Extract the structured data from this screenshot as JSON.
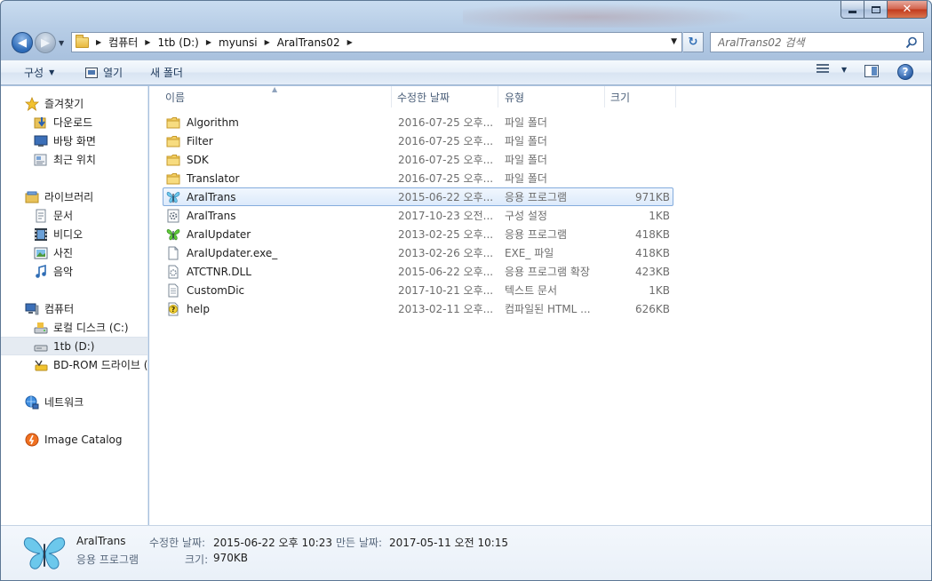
{
  "window": {
    "controls": {
      "minimize": "",
      "maximize": "",
      "close": "✕"
    }
  },
  "address": {
    "crumbs": [
      "컴퓨터",
      "1tb (D:)",
      "myunsi",
      "AralTrans02"
    ]
  },
  "search": {
    "placeholder": "AralTrans02 검색"
  },
  "toolbar": {
    "organize_label": "구성",
    "open_label": "열기",
    "new_folder_label": "새 폴더"
  },
  "nav": {
    "favorites": {
      "label": "즐겨찾기",
      "items": [
        "다운로드",
        "바탕 화면",
        "최근 위치"
      ]
    },
    "libraries": {
      "label": "라이브러리",
      "items": [
        "문서",
        "비디오",
        "사진",
        "음악"
      ]
    },
    "computer": {
      "label": "컴퓨터",
      "items": [
        "로컬 디스크 (C:)",
        "1tb (D:)",
        "BD-ROM 드라이브 ("
      ]
    },
    "network": {
      "label": "네트워크"
    },
    "image_catalog": {
      "label": "Image Catalog"
    }
  },
  "columns": {
    "name": "이름",
    "date": "수정한 날짜",
    "type": "유형",
    "size": "크기"
  },
  "files": [
    {
      "name": "Algorithm",
      "date": "2016-07-25 오후...",
      "type": "파일 폴더",
      "size": "",
      "icon": "folder-icon"
    },
    {
      "name": "Filter",
      "date": "2016-07-25 오후...",
      "type": "파일 폴더",
      "size": "",
      "icon": "folder-icon"
    },
    {
      "name": "SDK",
      "date": "2016-07-25 오후...",
      "type": "파일 폴더",
      "size": "",
      "icon": "folder-icon"
    },
    {
      "name": "Translator",
      "date": "2016-07-25 오후...",
      "type": "파일 폴더",
      "size": "",
      "icon": "folder-icon"
    },
    {
      "name": "AralTrans",
      "date": "2015-06-22 오후...",
      "type": "응용 프로그램",
      "size": "971KB",
      "icon": "butterfly-blue-icon"
    },
    {
      "name": "AralTrans",
      "date": "2017-10-23 오전...",
      "type": "구성 설정",
      "size": "1KB",
      "icon": "config-icon"
    },
    {
      "name": "AralUpdater",
      "date": "2013-02-25 오후...",
      "type": "응용 프로그램",
      "size": "418KB",
      "icon": "butterfly-green-icon"
    },
    {
      "name": "AralUpdater.exe_",
      "date": "2013-02-26 오후...",
      "type": "EXE_ 파일",
      "size": "418KB",
      "icon": "file-icon"
    },
    {
      "name": "ATCTNR.DLL",
      "date": "2015-06-22 오후...",
      "type": "응용 프로그램 확장",
      "size": "423KB",
      "icon": "dll-icon"
    },
    {
      "name": "CustomDic",
      "date": "2017-10-21 오후...",
      "type": "텍스트 문서",
      "size": "1KB",
      "icon": "text-file-icon"
    },
    {
      "name": "help",
      "date": "2013-02-11 오후...",
      "type": "컴파일된 HTML ...",
      "size": "626KB",
      "icon": "help-file-icon"
    }
  ],
  "details": {
    "name": "AralTrans",
    "type": "응용 프로그램",
    "modified_label": "수정한 날짜:",
    "modified_value": "2015-06-22 오후 10:23",
    "created_label": "만든 날짜:",
    "created_value": "2017-05-11 오전 10:15",
    "size_label": "크기:",
    "size_value": "970KB"
  },
  "colors": {
    "accent": "#84acdd",
    "selection_bg": "#dceafb",
    "toolbar_text": "#1e395b"
  }
}
